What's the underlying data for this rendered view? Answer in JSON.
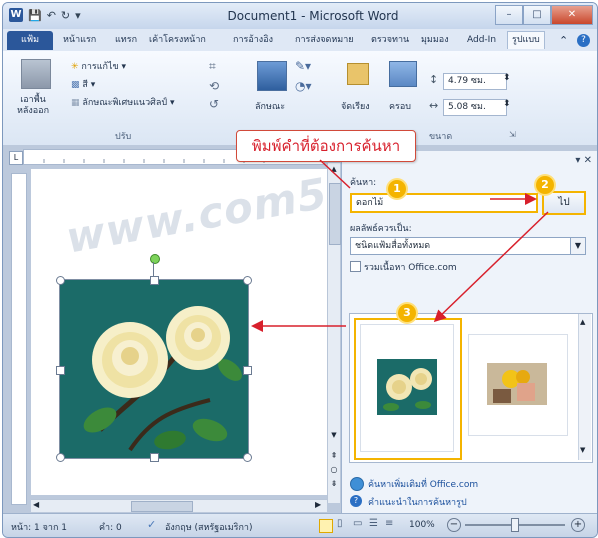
{
  "window": {
    "title": "Document1 - Microsoft Word",
    "buttons": {
      "minimize": "–",
      "maximize": "□",
      "close": "✕"
    }
  },
  "quick_access": {
    "app_icon": "W",
    "save_glyph": "💾",
    "undo_glyph": "↶",
    "redo_glyph": "↻",
    "customize_glyph": "▾"
  },
  "ribbon_tabs": [
    "แฟ้ม",
    "หน้าแรก",
    "แทรก",
    "เค้าโครงหน้าก",
    "การอ้างอิง",
    "การส่งจดหมาย",
    "ตรวจทาน",
    "มุมมอง",
    "Add-In",
    "รูปแบบ"
  ],
  "ribbon": {
    "remove_background": "เอาพื้น\nหลังออก",
    "corrections": "การแก้ไข",
    "color": "สี",
    "artistic_effects": "ลักษณะพิเศษแนวศิลป์",
    "group_adjust": "ปรับ",
    "picture_styles": "ลักษณะ",
    "arrange": "จัดเรียง",
    "crop": "ครอบ",
    "height": "4.79 ซม.",
    "width": "5.08 ซม.",
    "group_size": "ขนาด"
  },
  "callout_text": "พิมพ์คำที่ต้องการค้นหา",
  "watermark": "www.com5dee.com",
  "task_pane": {
    "close_glyph": "▾ ✕",
    "search_label": "ค้นหา:",
    "search_value": "ดอกไม้",
    "go_button": "ไป",
    "results_should_be": "ผลลัพธ์ควรเป็น:",
    "results_type": "ชนิดแฟ้มสื่อทั้งหมด",
    "include_office": "รวมเนื้อหา Office.com",
    "link_more": "ค้นหาเพิ่มเติมที่ Office.com",
    "link_tips": "คำแนะนำในการค้นหารูป"
  },
  "badges": [
    "1",
    "2",
    "3"
  ],
  "status_bar": {
    "page": "หน้า: 1 จาก 1",
    "words": "คำ: 0",
    "language": "อังกฤษ (สหรัฐอเมริกา)",
    "zoom": "100%"
  },
  "colors": {
    "accent": "#2b579a",
    "annotation_red": "#d8202c",
    "highlight_yellow": "#f4b400",
    "clipart_bg": "#1b6b68"
  }
}
